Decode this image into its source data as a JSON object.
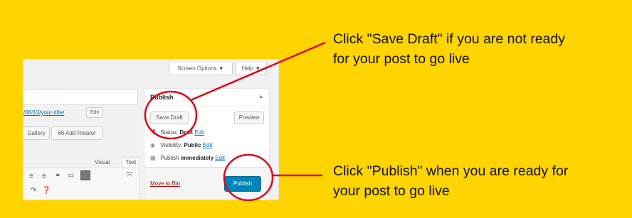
{
  "topbar": {
    "screen_options": "Screen Options ▼",
    "help": "Help ▼"
  },
  "editor": {
    "permalink": "/08/13/your-title/",
    "permalink_edit": "Edit",
    "gallery_button": "Gallery",
    "add_rotator_button": "66 Add Rotator",
    "tab_visual": "Visual",
    "tab_text": "Text"
  },
  "publish_box": {
    "title": "Publish",
    "toggle_icon": "triangle-up-icon",
    "save_draft": "Save Draft",
    "preview": "Preview",
    "status_label": "Status:",
    "status_value": "Draft",
    "status_edit": "Edit",
    "visibility_label": "Visibility:",
    "visibility_value": "Public",
    "visibility_edit": "Edit",
    "publish_label": "Publish",
    "publish_value": "immediately",
    "publish_edit": "Edit",
    "move_to_bin": "Move to Bin",
    "publish_button": "Publish"
  },
  "callouts": {
    "save_draft_line1": "Click \"Save Draft\" if you are not ready",
    "save_draft_line2": "for your post to go live",
    "publish_line1": "Click \"Publish\" when you are ready for",
    "publish_line2": "your post to go live"
  },
  "colors": {
    "background": "#ffd400",
    "annotation": "#e0001a",
    "publish_button": "#0085ba",
    "link": "#0073aa"
  }
}
